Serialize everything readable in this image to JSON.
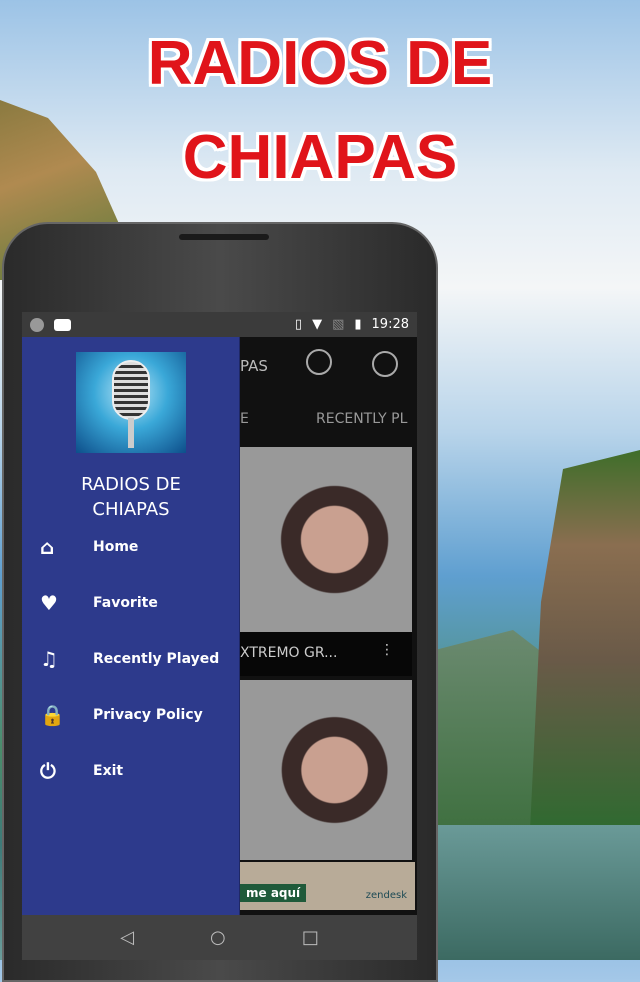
{
  "promo": {
    "title_line1": "RADIOS DE",
    "title_line2": "CHIAPAS"
  },
  "status_bar": {
    "time": "19:28"
  },
  "app": {
    "title_partial": "PAS",
    "tabs": [
      "E",
      "RECENTLY PL"
    ],
    "cards": [
      {
        "caption": "XTREMO GR..."
      },
      {
        "caption": ""
      }
    ],
    "ad": {
      "text": "me aquí",
      "brand": "zendesk"
    }
  },
  "drawer": {
    "title": "RADIOS DE CHIAPAS",
    "items": [
      {
        "label": "Home",
        "icon": "home-icon"
      },
      {
        "label": "Favorite",
        "icon": "heart-icon"
      },
      {
        "label": "Recently Played",
        "icon": "music-note-icon"
      },
      {
        "label": "Privacy Policy",
        "icon": "lock-icon"
      },
      {
        "label": "Exit",
        "icon": "power-icon"
      }
    ]
  },
  "colors": {
    "drawer": "#2d3a8c",
    "title_red": "#e0141a"
  }
}
